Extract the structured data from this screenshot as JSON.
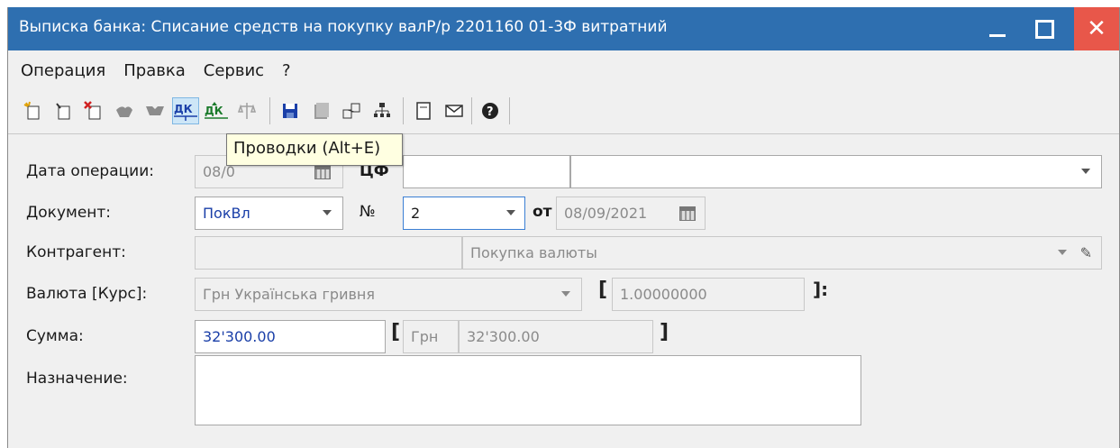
{
  "window": {
    "title": "Выписка банка: Списание средств на покупку валР/р 2201160 01-3Ф витратний",
    "close_glyph": "✕"
  },
  "menu": [
    "Операция",
    "Правка",
    "Сервис",
    "?"
  ],
  "toolbar": {
    "icons": [
      "new-doc-icon",
      "copy-doc-icon",
      "delete-doc-icon",
      "hands-icon",
      "handshake-icon",
      "dk-icon",
      "dk-up-icon",
      "scales-icon",
      "save-icon",
      "archive-icon",
      "link-icon",
      "tree-icon",
      "form-icon",
      "mail-icon",
      "help-icon"
    ],
    "dk_label": "ДК"
  },
  "tooltip": "Проводки (Alt+E)",
  "form": {
    "date_label": "Дата операции:",
    "date_value": "08/0",
    "cfo_label": "ЦФ",
    "document_label": "Документ:",
    "document_value": "ПокВл",
    "number_label": "№",
    "number_value": "2",
    "from_label": "от",
    "doc_date": "08/09/2021",
    "counterparty_label": "Контрагент:",
    "counterparty_value": "Покупка валюты",
    "currency_label": "Валюта [Курс]:",
    "currency_value": "Грн Українська гривня",
    "rate_open": "[",
    "rate_value": "1.00000000",
    "rate_close": "]:",
    "sum_label": "Сумма:",
    "sum_value": "32'300.00",
    "sum_open": "[",
    "sum_currency": "Грн",
    "sum_converted": "32'300.00",
    "sum_close": "]",
    "purpose_label": "Назначение:",
    "purpose_value": ""
  }
}
